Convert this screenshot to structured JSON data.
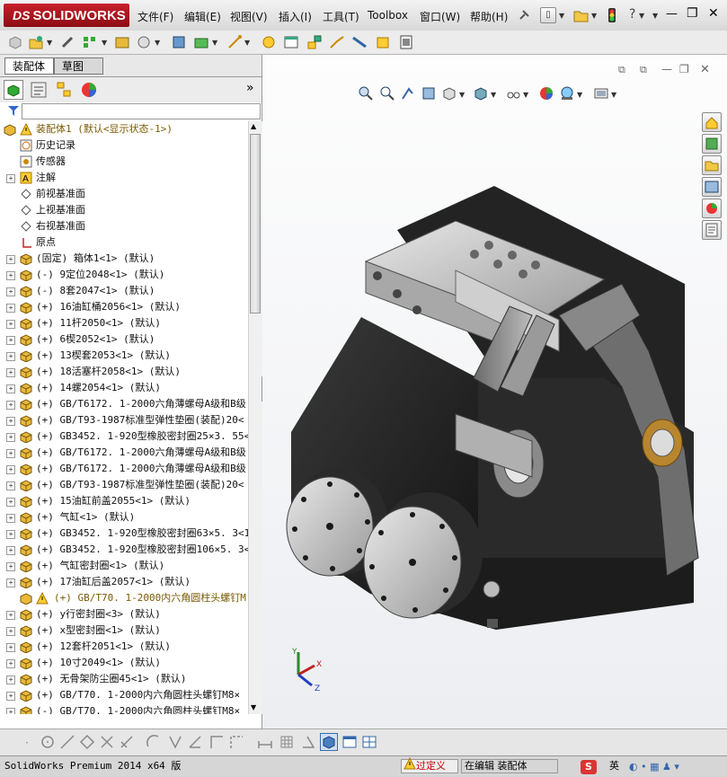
{
  "app": {
    "logo_text": "SOLIDWORKS",
    "logo_ds": "DS"
  },
  "menu": {
    "items": [
      "文件(F)",
      "编辑(E)",
      "视图(V)",
      "插入(I)",
      "工具(T)",
      "Toolbox",
      "窗口(W)",
      "帮助(H)"
    ]
  },
  "window_controls": {
    "minimize": "—",
    "restore": "❐",
    "close": "✕"
  },
  "left_panel": {
    "tabs": [
      "装配体",
      "草图"
    ],
    "expand_arrow": "»",
    "tree_root": "装配体1  (默认<显示状态-1>)",
    "tree_items": [
      {
        "label": "历史记录",
        "type": "history",
        "expand": false
      },
      {
        "label": "传感器",
        "type": "sensor",
        "expand": false
      },
      {
        "label": "注解",
        "type": "annotation",
        "expand": true
      },
      {
        "label": "前视基准面",
        "type": "plane",
        "expand": false
      },
      {
        "label": "上视基准面",
        "type": "plane",
        "expand": false
      },
      {
        "label": "右视基准面",
        "type": "plane",
        "expand": false
      },
      {
        "label": "原点",
        "type": "origin",
        "expand": false
      },
      {
        "label": "(固定) 箱体1<1> (默认)",
        "type": "part",
        "expand": true
      },
      {
        "label": "(-) 9定位2048<1> (默认)",
        "type": "part",
        "expand": true
      },
      {
        "label": "(-) 8套2047<1> (默认)",
        "type": "part",
        "expand": true
      },
      {
        "label": "(+) 16油缸桶2056<1> (默认)",
        "type": "part",
        "expand": true
      },
      {
        "label": "(+) 11杆2050<1> (默认)",
        "type": "part",
        "expand": true
      },
      {
        "label": "(+) 6楔2052<1> (默认)",
        "type": "part",
        "expand": true
      },
      {
        "label": "(+) 13楔套2053<1> (默认)",
        "type": "part",
        "expand": true
      },
      {
        "label": "(+) 18活塞杆2058<1> (默认)",
        "type": "part",
        "expand": true
      },
      {
        "label": "(+) 14螺2054<1> (默认)",
        "type": "part",
        "expand": true
      },
      {
        "label": "(+) GB/T6172. 1-2000六角薄螺母A级和B级",
        "type": "part",
        "expand": true
      },
      {
        "label": "(+) GB/T93-1987标准型弹性垫圈(装配)20<",
        "type": "part",
        "expand": true
      },
      {
        "label": "(+) GB3452. 1-920型橡胶密封圈25×3. 55<",
        "type": "part",
        "expand": true
      },
      {
        "label": "(+) GB/T6172. 1-2000六角薄螺母A级和B级",
        "type": "part",
        "expand": true
      },
      {
        "label": "(+) GB/T6172. 1-2000六角薄螺母A级和B级",
        "type": "part",
        "expand": true
      },
      {
        "label": "(+) GB/T93-1987标准型弹性垫圈(装配)20<",
        "type": "part",
        "expand": true
      },
      {
        "label": "(+) 15油缸前盖2055<1> (默认)",
        "type": "part",
        "expand": true
      },
      {
        "label": "(+) 气缸<1> (默认)",
        "type": "part",
        "expand": true
      },
      {
        "label": "(+) GB3452. 1-920型橡胶密封圈63×5. 3<1",
        "type": "part",
        "expand": true
      },
      {
        "label": "(+) GB3452. 1-920型橡胶密封圈106×5. 3<",
        "type": "part",
        "expand": true
      },
      {
        "label": "(+) 气缸密封圈<1> (默认)",
        "type": "part",
        "expand": true
      },
      {
        "label": "(+) 17油缸后盖2057<1> (默认)",
        "type": "part",
        "expand": true
      },
      {
        "label": "(+) GB/T70. 1-2000内六角圆柱头螺钉M",
        "type": "warn",
        "expand": false
      },
      {
        "label": "(+) y行密封圈<3> (默认)",
        "type": "part",
        "expand": true
      },
      {
        "label": "(+) x型密封圈<1> (默认)",
        "type": "part",
        "expand": true
      },
      {
        "label": "(+) 12套杆2051<1> (默认)",
        "type": "part",
        "expand": true
      },
      {
        "label": "(+) 10寸2049<1> (默认)",
        "type": "part",
        "expand": true
      },
      {
        "label": "(+) 无骨架防尘圈45<1> (默认)",
        "type": "part",
        "expand": true
      },
      {
        "label": "(+) GB/T70. 1-2000内六角圆柱头螺钉M8×",
        "type": "part",
        "expand": true
      },
      {
        "label": "(-) GB/T70. 1-2000内六角圆柱头螺钉M8×",
        "type": "part",
        "expand": true
      }
    ]
  },
  "status": {
    "app_version": "SolidWorks Premium 2014 x64 版",
    "overdefined": "过定义",
    "editing": "在编辑 装配体",
    "ime": "英"
  },
  "triad": {
    "x": "X",
    "y": "Y",
    "z": "Z"
  },
  "colors": {
    "brand_red": "#b5121b",
    "overdefined_red": "#cc0000",
    "part_dark": "#2a2a2a",
    "part_silver": "#c8c8c8",
    "bronze": "#b8862e"
  }
}
